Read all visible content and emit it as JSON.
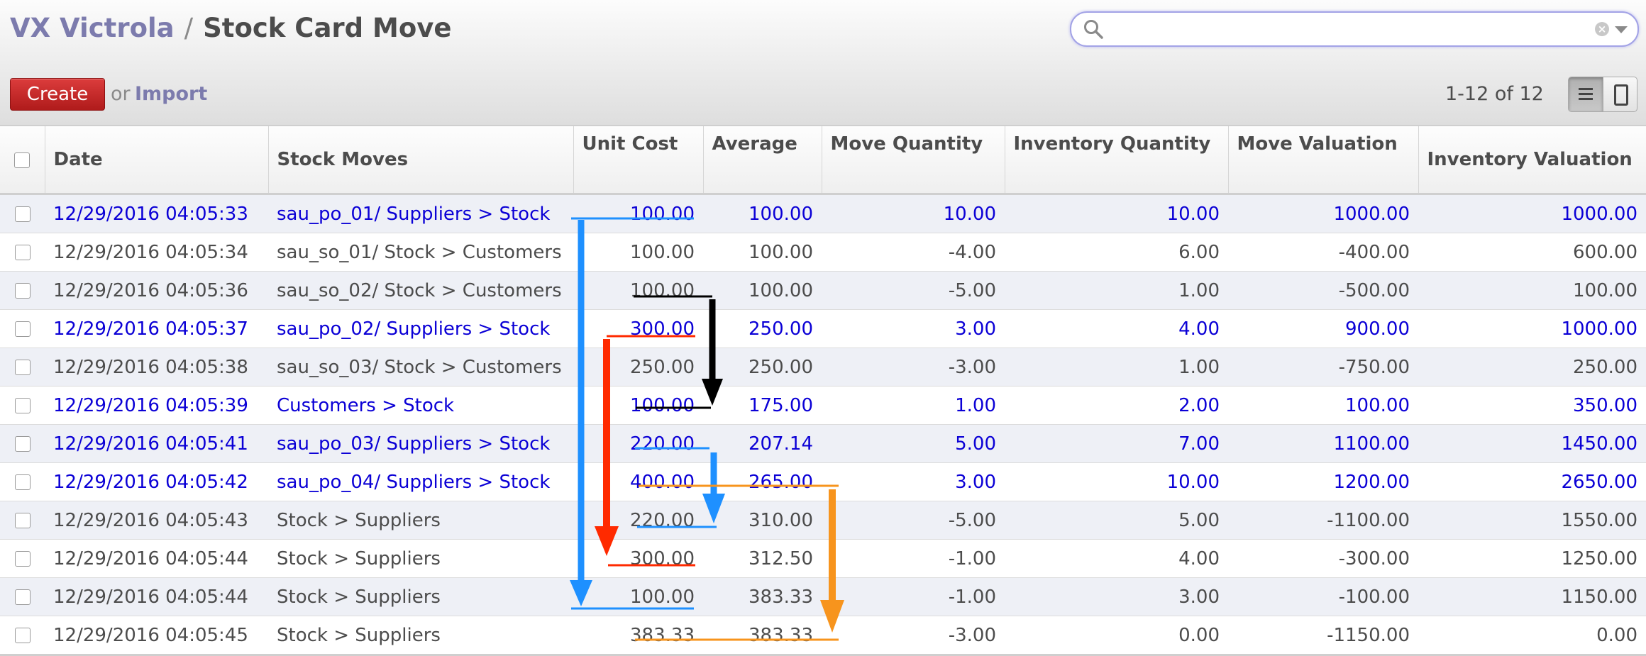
{
  "breadcrumb": {
    "parent": "VX Victrola",
    "separator": "/",
    "current": "Stock Card Move"
  },
  "search": {
    "placeholder": "",
    "value": ""
  },
  "toolbar": {
    "create_label": "Create",
    "or_text": "or",
    "import_label": "Import"
  },
  "pager": {
    "text": "1-12 of 12"
  },
  "table": {
    "columns": [
      "Date",
      "Stock Moves",
      "Unit Cost",
      "Average",
      "Move Quantity",
      "Inventory Quantity",
      "Move Valuation",
      "Inventory Valuation"
    ],
    "rows": [
      {
        "incoming": true,
        "date": "12/29/2016 04:05:33",
        "move": "sau_po_01/ Suppliers > Stock",
        "unit_cost": "100.00",
        "average": "100.00",
        "move_qty": "10.00",
        "inv_qty": "10.00",
        "move_val": "1000.00",
        "inv_val": "1000.00"
      },
      {
        "incoming": false,
        "date": "12/29/2016 04:05:34",
        "move": "sau_so_01/ Stock > Customers",
        "unit_cost": "100.00",
        "average": "100.00",
        "move_qty": "-4.00",
        "inv_qty": "6.00",
        "move_val": "-400.00",
        "inv_val": "600.00"
      },
      {
        "incoming": false,
        "date": "12/29/2016 04:05:36",
        "move": "sau_so_02/ Stock > Customers",
        "unit_cost": "100.00",
        "average": "100.00",
        "move_qty": "-5.00",
        "inv_qty": "1.00",
        "move_val": "-500.00",
        "inv_val": "100.00"
      },
      {
        "incoming": true,
        "date": "12/29/2016 04:05:37",
        "move": "sau_po_02/ Suppliers > Stock",
        "unit_cost": "300.00",
        "average": "250.00",
        "move_qty": "3.00",
        "inv_qty": "4.00",
        "move_val": "900.00",
        "inv_val": "1000.00"
      },
      {
        "incoming": false,
        "date": "12/29/2016 04:05:38",
        "move": "sau_so_03/ Stock > Customers",
        "unit_cost": "250.00",
        "average": "250.00",
        "move_qty": "-3.00",
        "inv_qty": "1.00",
        "move_val": "-750.00",
        "inv_val": "250.00"
      },
      {
        "incoming": true,
        "date": "12/29/2016 04:05:39",
        "move": "Customers > Stock",
        "unit_cost": "100.00",
        "average": "175.00",
        "move_qty": "1.00",
        "inv_qty": "2.00",
        "move_val": "100.00",
        "inv_val": "350.00"
      },
      {
        "incoming": true,
        "date": "12/29/2016 04:05:41",
        "move": "sau_po_03/ Suppliers > Stock",
        "unit_cost": "220.00",
        "average": "207.14",
        "move_qty": "5.00",
        "inv_qty": "7.00",
        "move_val": "1100.00",
        "inv_val": "1450.00"
      },
      {
        "incoming": true,
        "date": "12/29/2016 04:05:42",
        "move": "sau_po_04/ Suppliers > Stock",
        "unit_cost": "400.00",
        "average": "265.00",
        "move_qty": "3.00",
        "inv_qty": "10.00",
        "move_val": "1200.00",
        "inv_val": "2650.00"
      },
      {
        "incoming": false,
        "date": "12/29/2016 04:05:43",
        "move": "Stock > Suppliers",
        "unit_cost": "220.00",
        "average": "310.00",
        "move_qty": "-5.00",
        "inv_qty": "5.00",
        "move_val": "-1100.00",
        "inv_val": "1550.00"
      },
      {
        "incoming": false,
        "date": "12/29/2016 04:05:44",
        "move": "Stock > Suppliers",
        "unit_cost": "300.00",
        "average": "312.50",
        "move_qty": "-1.00",
        "inv_qty": "4.00",
        "move_val": "-300.00",
        "inv_val": "1250.00"
      },
      {
        "incoming": false,
        "date": "12/29/2016 04:05:44",
        "move": "Stock > Suppliers",
        "unit_cost": "100.00",
        "average": "383.33",
        "move_qty": "-1.00",
        "inv_qty": "3.00",
        "move_val": "-100.00",
        "inv_val": "1150.00"
      },
      {
        "incoming": false,
        "date": "12/29/2016 04:05:45",
        "move": "Stock > Suppliers",
        "unit_cost": "383.33",
        "average": "383.33",
        "move_qty": "-3.00",
        "inv_qty": "0.00",
        "move_val": "-1150.00",
        "inv_val": "0.00"
      }
    ]
  },
  "colors": {
    "incoming_text": "#0b00d6",
    "accent_purple": "#7c7bad",
    "create_button": "#c52727",
    "arrow_blue": "#1e90ff",
    "arrow_red": "#ff2a00",
    "arrow_black": "#000000",
    "arrow_orange": "#f7941d"
  },
  "icons": {
    "search": "search-icon",
    "clear": "clear-icon",
    "dropdown": "dropdown-icon",
    "list_view": "list-view-icon",
    "form_view": "form-view-icon"
  }
}
